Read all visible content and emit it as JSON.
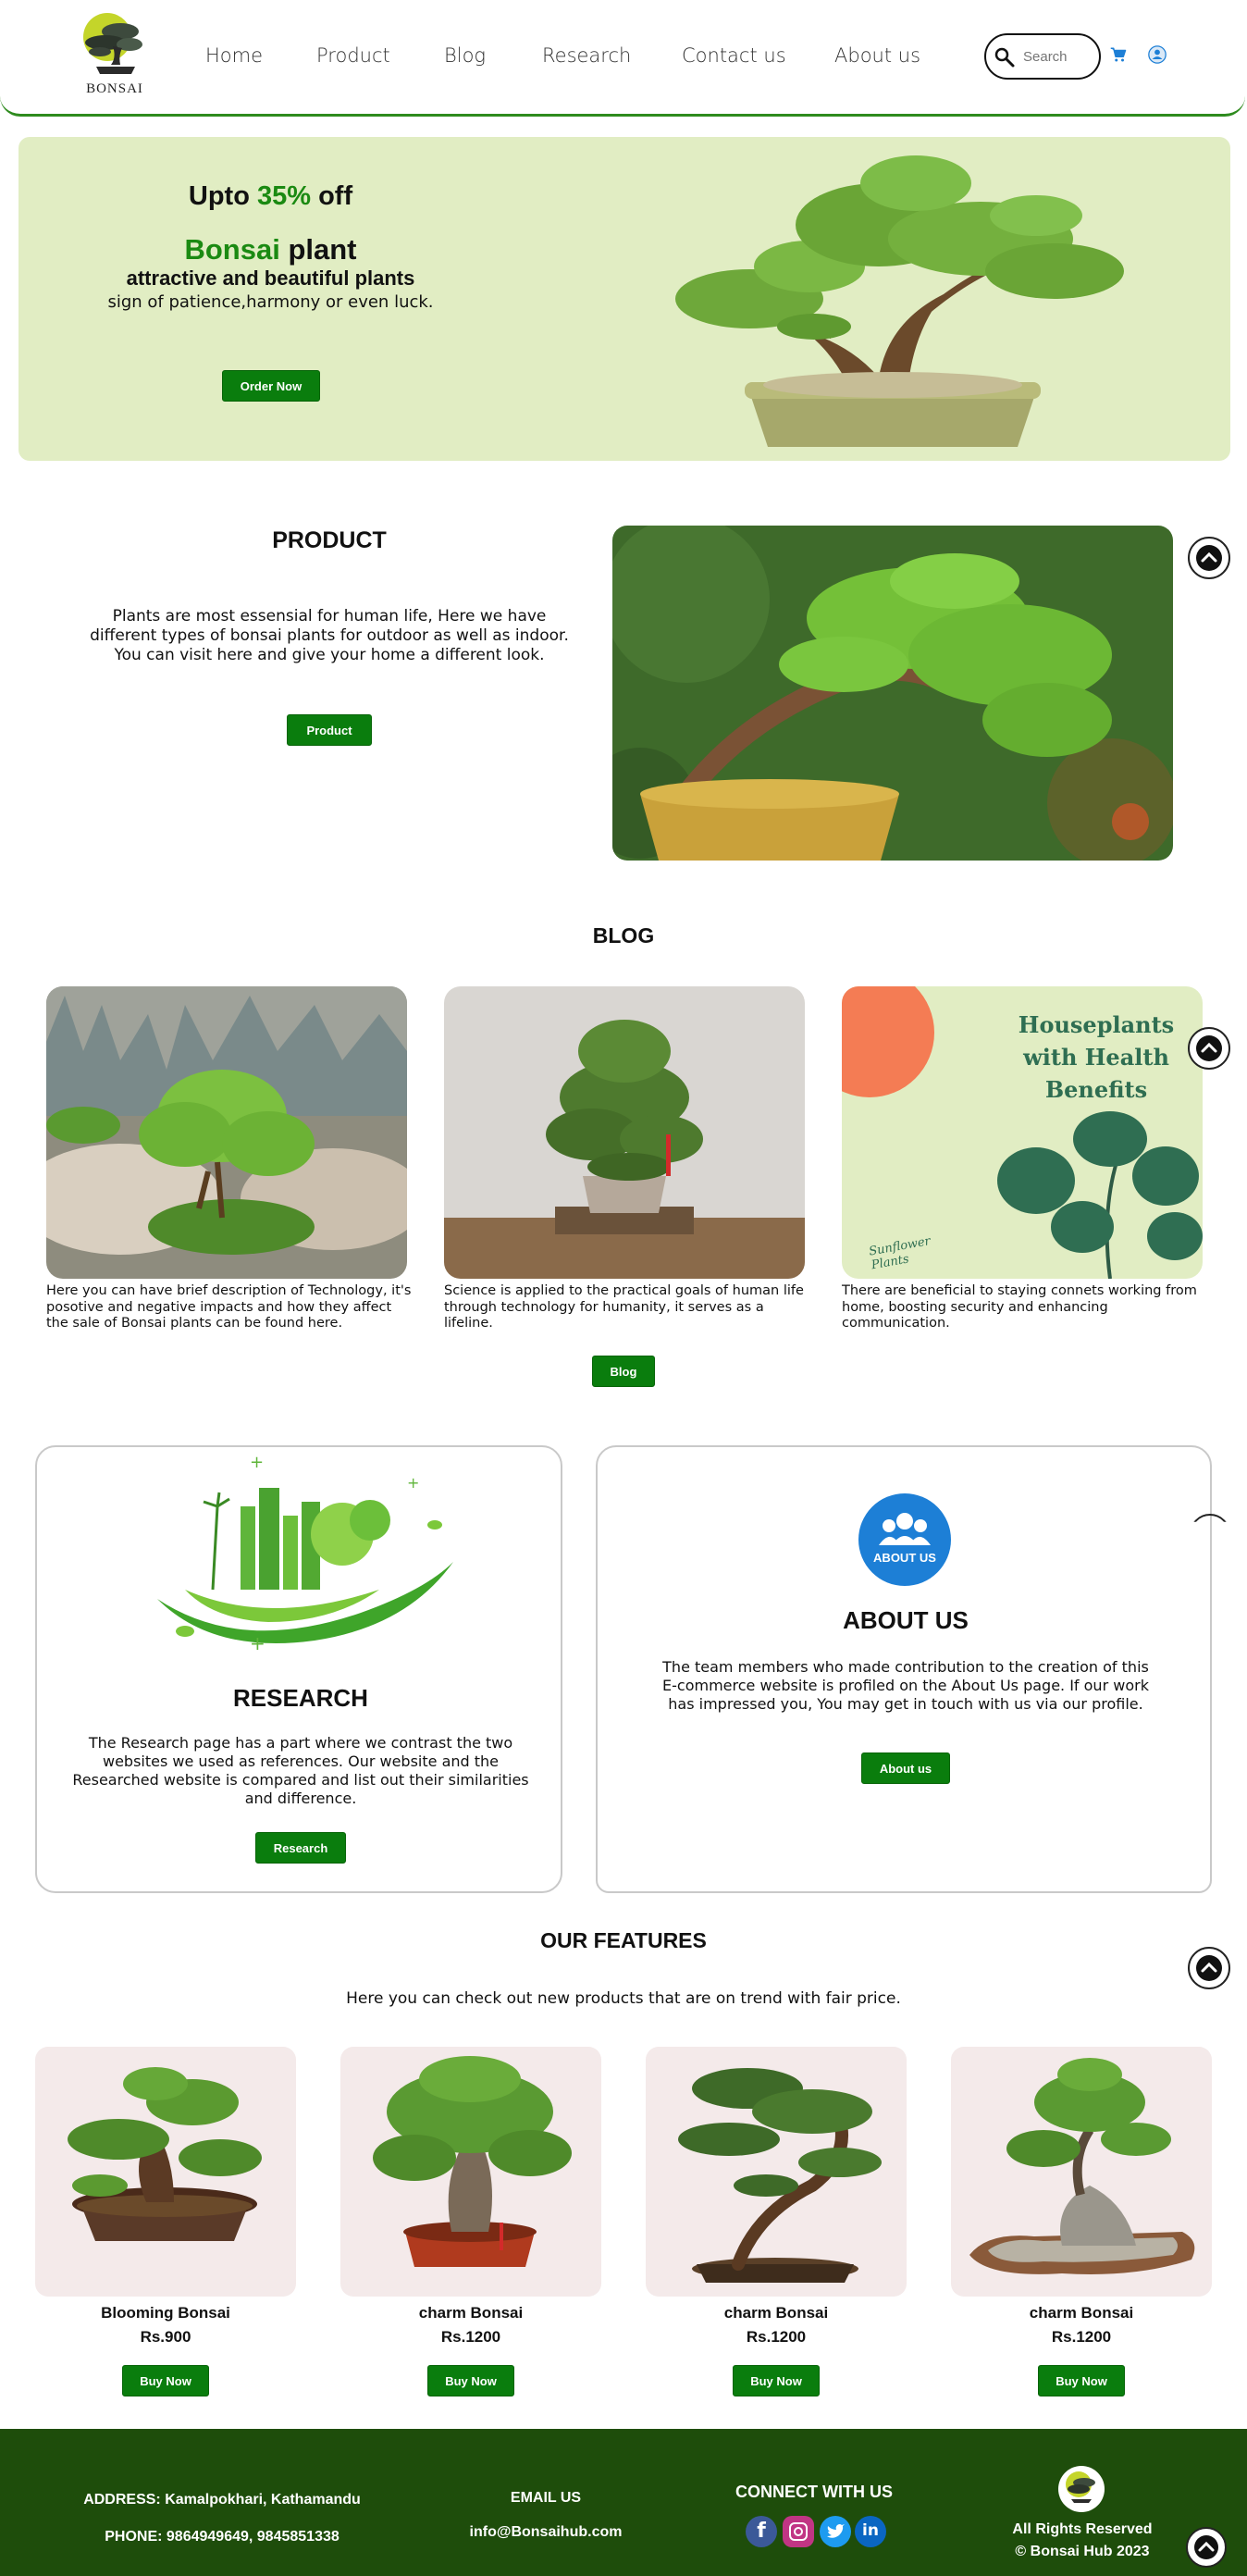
{
  "header": {
    "logo_text": "BONSAI",
    "nav": [
      "Home",
      "Product",
      "Blog",
      "Research",
      "Contact us",
      "About us"
    ],
    "search_placeholder": "Search"
  },
  "hero": {
    "offer_prefix": "Upto ",
    "offer_percent": "35%",
    "offer_suffix": " off",
    "title_green": "Bonsai",
    "title_rest": " plant",
    "subtitle": "attractive and beautiful plants",
    "desc": "sign of patience,harmony or even luck.",
    "button": "Order Now"
  },
  "product": {
    "title": "PRODUCT",
    "text": "Plants are most essensial for human life, Here we have different types of bonsai plants for outdoor as well as indoor. You can visit here and give your home a different look.",
    "button": "Product"
  },
  "blog": {
    "title": "BLOG",
    "cards": [
      {
        "text": "Here you can have brief description of Technology, it's posotive and negative impacts and how they affect the sale of Bonsai plants can be found here."
      },
      {
        "text": "Science is applied to the practical goals of human life through technology for humanity, it serves as a lifeline."
      },
      {
        "text": "There are beneficial to staying connets working from home, boosting security and enhancing communication.",
        "image_title": "Houseplants with Health Benefits",
        "image_script": "Sunflower Plants"
      }
    ],
    "button": "Blog"
  },
  "research": {
    "title": "RESEARCH",
    "text": "The Research page has a part where we contrast the two websites we used as references. Our website and the Researched website is compared and list out their similarities and difference.",
    "button": "Research"
  },
  "about": {
    "badge": "ABOUT US",
    "title": "ABOUT US",
    "text": "The team members who made contribution to the creation of this E-commerce website is profiled on the About Us page. If our work has impressed you, You may get in touch with us via our profile.",
    "button": "About us"
  },
  "features": {
    "title": "OUR FEATURES",
    "subtitle": "Here you can check out new products that are on trend with fair price.",
    "items": [
      {
        "name": "Blooming Bonsai",
        "price": "Rs.900",
        "button": "Buy Now"
      },
      {
        "name": "charm Bonsai",
        "price": "Rs.1200",
        "button": "Buy Now"
      },
      {
        "name": "charm Bonsai",
        "price": "Rs.1200",
        "button": "Buy Now"
      },
      {
        "name": "charm Bonsai",
        "price": "Rs.1200",
        "button": "Buy Now"
      }
    ]
  },
  "footer": {
    "address": "ADDRESS: Kamalpokhari, Kathamandu",
    "phone": "PHONE: 9864949649, 9845851338",
    "email_label": "EMAIL US",
    "email": "info@Bonsaihub.com",
    "connect": "CONNECT WITH US",
    "rights": "All Rights Reserved",
    "copyright": "© Bonsai Hub 2023",
    "social_icons": [
      "facebook-icon",
      "instagram-icon",
      "twitter-icon",
      "linkedin-icon"
    ]
  },
  "colors": {
    "brand_green": "#0a7d0d",
    "hero_bg": "#e1edc3",
    "footer_bg": "#1e4d0b",
    "card_bg": "#f4eaea"
  }
}
